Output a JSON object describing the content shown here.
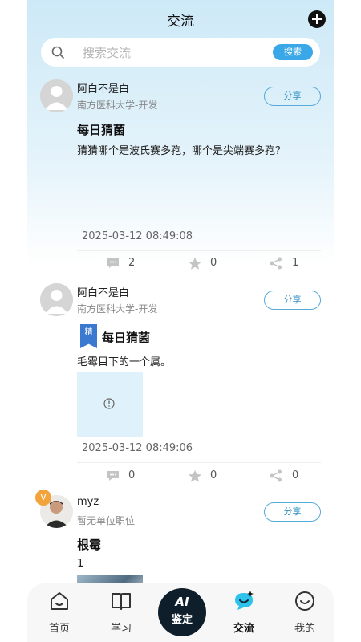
{
  "header": {
    "title": "交流"
  },
  "search": {
    "placeholder": "搜索交流",
    "button": "搜索"
  },
  "posts": [
    {
      "user": "阿白不是白",
      "org": "南方医科大学-开发",
      "share": "分享",
      "title": "每日猜菌",
      "body": "猜猜哪个是波氏赛多孢，哪个是尖端赛多孢？",
      "time": "2025-03-12 08:49:08",
      "comments": "2",
      "favorites": "0",
      "shares": "1"
    },
    {
      "user": "阿白不是白",
      "org": "南方医科大学-开发",
      "share": "分享",
      "tag": "精",
      "title": "每日猜菌",
      "body": "毛霉目下的一个属。",
      "time": "2025-03-12 08:49:06",
      "comments": "0",
      "favorites": "0",
      "shares": "0"
    },
    {
      "user": "myz",
      "org": "暂无单位职位",
      "share": "分享",
      "badge": "V",
      "title": "根霉",
      "body": "1"
    }
  ],
  "tabs": [
    {
      "label": "首页",
      "icon": "home-icon"
    },
    {
      "label": "学习",
      "icon": "book-icon"
    },
    {
      "label": "鉴定",
      "icon": "ai-identify-icon",
      "badge_text": "AI"
    },
    {
      "label": "交流",
      "icon": "chat-icon",
      "active": true
    },
    {
      "label": "我的",
      "icon": "profile-icon"
    }
  ],
  "colors": {
    "accent": "#3aa8e8",
    "tag": "#3b78d0",
    "ai_button": "#0e1f2b"
  }
}
